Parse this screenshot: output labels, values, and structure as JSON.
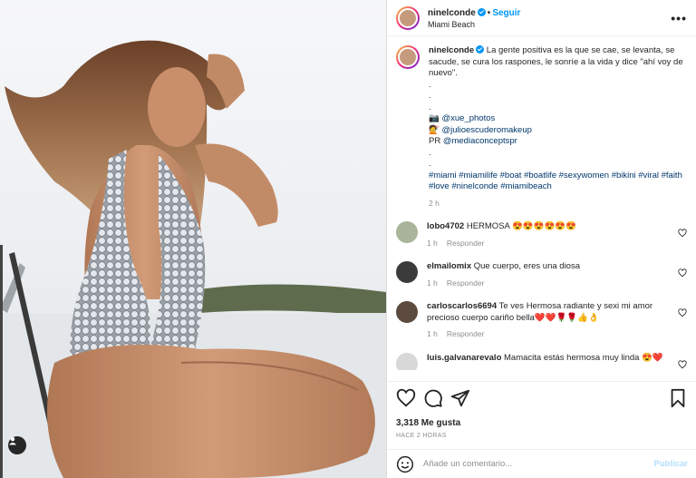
{
  "post": {
    "username": "ninelconde",
    "follow_label": "Seguir",
    "location": "Miami Beach",
    "more_label": "•••"
  },
  "caption": {
    "username": "ninelconde",
    "text": "La gente positiva es la que se cae, se levanta, se sacude, se cura los raspones, le sonríe a la vida y dice \"ahí voy de nuevo\".",
    "dots": [
      ".",
      ".",
      "."
    ],
    "credit1_icon": "📷",
    "credit1": "@xue_photos",
    "credit2_icon": "💇",
    "credit2": "@julioescuderomakeup",
    "credit3_prefix": "PR",
    "credit3": "@mediaconceptspr",
    "dots2": [
      ".",
      "."
    ],
    "hashtags": "#miami #miamilife #boat #boatlife #sexywomen #bikini #viral #faith #love #ninelconde #miamibeach",
    "time": "2 h"
  },
  "comments": [
    {
      "user": "lobo4702",
      "text": "HERMOSA 😍😍😍😍😍😍",
      "time": "1 h",
      "reply": "Responder",
      "avatar_color": "#a9b49a"
    },
    {
      "user": "elmailomix",
      "text": "Que cuerpo, eres una diosa",
      "time": "1 h",
      "reply": "Responder",
      "avatar_color": "#3b3b3b"
    },
    {
      "user": "carloscarlos6694",
      "text": "Te ves Hermosa radiante y sexi mi amor precioso cuerpo cariño bella❤️❤️🌹🌹👍👌",
      "time": "1 h",
      "reply": "Responder",
      "avatar_color": "#5b4a3d"
    },
    {
      "user": "luis.galvanarevalo",
      "text": "Mamacita estás hermosa muy linda 😍❤️",
      "time": "",
      "reply": "",
      "avatar_color": "#d8d8d8"
    }
  ],
  "actions": {
    "likes": "3,318 Me gusta",
    "ago": "HACE 2 HORAS",
    "comment_placeholder": "Añade un comentario...",
    "publish_label": "Publicar"
  },
  "colors": {
    "accent": "#0095f6",
    "text": "#262626",
    "muted": "#8e8e8e",
    "heart": "#ed4956"
  }
}
